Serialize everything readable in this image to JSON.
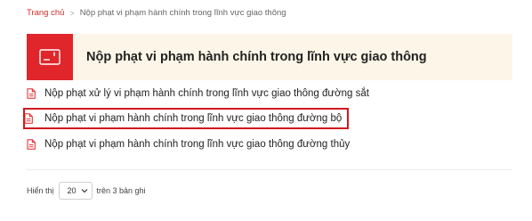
{
  "breadcrumb": {
    "home": "Trang chủ",
    "separator": ">",
    "current": "Nộp phạt vi phạm hành chính trong lĩnh vực giao thông"
  },
  "header": {
    "icon": "card-icon",
    "title": "Nộp phạt vi phạm hành chính trong lĩnh vực giao thông"
  },
  "items": [
    {
      "icon": "document-icon",
      "label": "Nộp phạt xử lý vi phạm hành chính trong lĩnh vực giao thông đường sắt",
      "highlighted": false
    },
    {
      "icon": "document-icon",
      "label": "Nộp phạt vi phạm hành chính trong lĩnh vực giao thông đường bộ",
      "highlighted": true
    },
    {
      "icon": "document-icon",
      "label": "Nộp phạt vi phạm hành chính trong lĩnh vực giao thông đường thủy",
      "highlighted": false
    }
  ],
  "pager": {
    "show_label": "Hiển thị",
    "page_size": "20",
    "total_label": "trên 3 bản ghi"
  },
  "colors": {
    "accent": "#e0262a",
    "highlight_border": "#d0191f",
    "header_bg": "#fdf6e8"
  }
}
